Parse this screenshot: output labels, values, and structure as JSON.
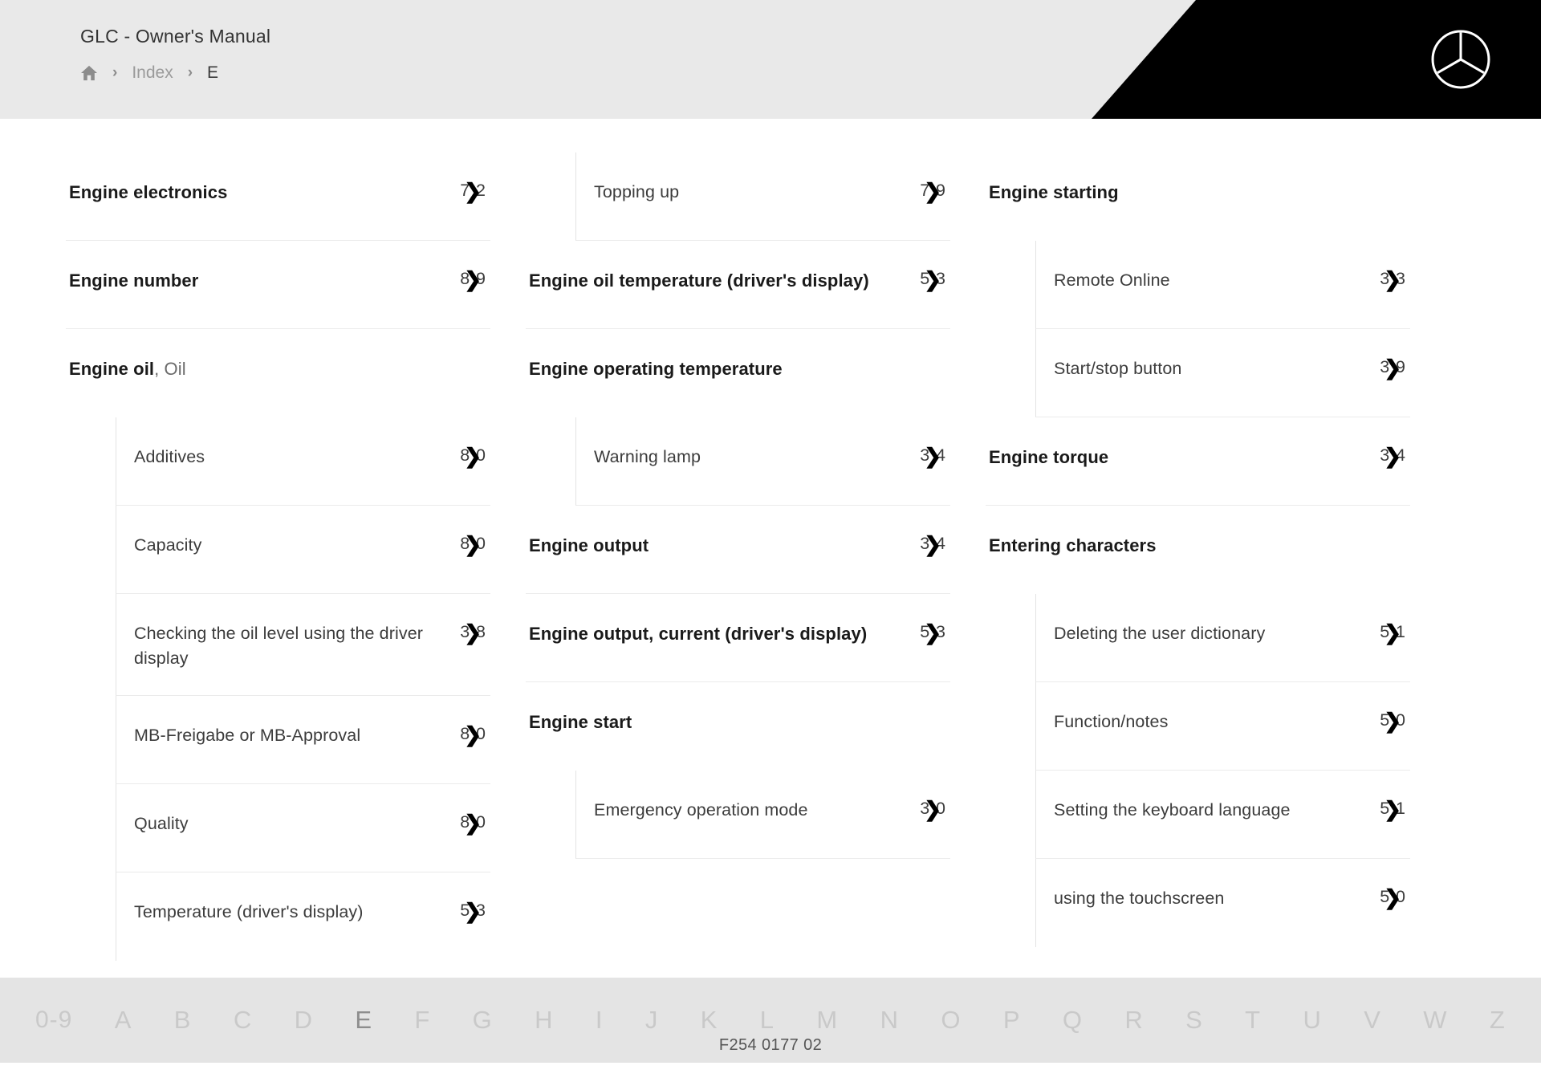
{
  "header": {
    "manual_title": "GLC - Owner's Manual",
    "breadcrumb": {
      "home_icon": "home-icon",
      "separator": "›",
      "items": [
        {
          "label": "Index",
          "current": false
        },
        {
          "label": "E",
          "current": true
        }
      ]
    },
    "brand_logo": "mercedes-benz-star-icon"
  },
  "index": {
    "columns": [
      {
        "entries": [
          {
            "label": "Engine electronics",
            "bold": true,
            "level": 0,
            "page": {
              "d1": "7",
              "chevron": "❯",
              "d2": "2"
            },
            "divider": true
          },
          {
            "label": "Engine number",
            "bold": true,
            "level": 0,
            "page": {
              "d1": "8",
              "chevron": "❯",
              "d2": "9"
            },
            "divider": true
          },
          {
            "label": "Engine oil",
            "suffix": ", Oil",
            "bold": true,
            "level": 0,
            "page": null,
            "divider": false
          },
          {
            "label": "Additives",
            "bold": false,
            "level": 1,
            "page": {
              "d1": "8",
              "chevron": "❯",
              "d2": "0"
            },
            "divider": true
          },
          {
            "label": "Capacity",
            "bold": false,
            "level": 1,
            "page": {
              "d1": "8",
              "chevron": "❯",
              "d2": "0"
            },
            "divider": true
          },
          {
            "label": "Checking the oil level using the driver display",
            "bold": false,
            "level": 1,
            "page": {
              "d1": "3",
              "chevron": "❯",
              "d2": "8"
            },
            "divider": true
          },
          {
            "label": "MB-Freigabe or MB-Approval",
            "bold": false,
            "level": 1,
            "page": {
              "d1": "8",
              "chevron": "❯",
              "d2": "0"
            },
            "divider": true
          },
          {
            "label": "Quality",
            "bold": false,
            "level": 1,
            "page": {
              "d1": "8",
              "chevron": "❯",
              "d2": "0"
            },
            "divider": true
          },
          {
            "label": "Temperature (driver's display)",
            "bold": false,
            "level": 1,
            "page": {
              "d1": "5",
              "chevron": "❯",
              "d2": "3"
            },
            "divider": false
          }
        ]
      },
      {
        "entries": [
          {
            "label": "Topping up",
            "bold": false,
            "level": 1,
            "page": {
              "d1": "7",
              "chevron": "❯",
              "d2": "9"
            },
            "divider": true
          },
          {
            "label": "Engine oil temperature (driver's display)",
            "bold": true,
            "level": 0,
            "page": {
              "d1": "5",
              "chevron": "❯",
              "d2": "3"
            },
            "divider": true
          },
          {
            "label": "Engine operating temperature",
            "bold": true,
            "level": 0,
            "page": null,
            "divider": false
          },
          {
            "label": "Warning lamp",
            "bold": false,
            "level": 1,
            "page": {
              "d1": "3",
              "chevron": "❯",
              "d2": "4"
            },
            "divider": true
          },
          {
            "label": "Engine output",
            "bold": true,
            "level": 0,
            "page": {
              "d1": "3",
              "chevron": "❯",
              "d2": "4"
            },
            "divider": true
          },
          {
            "label": "Engine output, current (driver's display)",
            "bold": true,
            "level": 0,
            "page": {
              "d1": "5",
              "chevron": "❯",
              "d2": "3"
            },
            "divider": true
          },
          {
            "label": "Engine start",
            "bold": true,
            "level": 0,
            "page": null,
            "divider": false
          },
          {
            "label": "Emergency operation mode",
            "bold": false,
            "level": 1,
            "page": {
              "d1": "3",
              "chevron": "❯",
              "d2": "0"
            },
            "divider": true
          }
        ]
      },
      {
        "entries": [
          {
            "label": "Engine starting",
            "bold": true,
            "level": 0,
            "page": null,
            "divider": false
          },
          {
            "label": "Remote Online",
            "bold": false,
            "level": 1,
            "page": {
              "d1": "3",
              "chevron": "❯",
              "d2": "3"
            },
            "divider": true
          },
          {
            "label": "Start/stop button",
            "bold": false,
            "level": 1,
            "page": {
              "d1": "3",
              "chevron": "❯",
              "d2": "9"
            },
            "divider": true
          },
          {
            "label": "Engine torque",
            "bold": true,
            "level": 0,
            "page": {
              "d1": "3",
              "chevron": "❯",
              "d2": "4"
            },
            "divider": true
          },
          {
            "label": "Entering characters",
            "bold": true,
            "level": 0,
            "page": null,
            "divider": false
          },
          {
            "label": "Deleting the user dictionary",
            "bold": false,
            "level": 1,
            "page": {
              "d1": "5",
              "chevron": "❯",
              "d2": "1"
            },
            "divider": true
          },
          {
            "label": "Function/notes",
            "bold": false,
            "level": 1,
            "page": {
              "d1": "5",
              "chevron": "❯",
              "d2": "0"
            },
            "divider": true
          },
          {
            "label": "Setting the keyboard language",
            "bold": false,
            "level": 1,
            "page": {
              "d1": "5",
              "chevron": "❯",
              "d2": "1"
            },
            "divider": true
          },
          {
            "label": "using the touchscreen",
            "bold": false,
            "level": 1,
            "page": {
              "d1": "5",
              "chevron": "❯",
              "d2": "0"
            },
            "divider": false
          }
        ]
      }
    ]
  },
  "alphabet_bar": {
    "active": "E",
    "items": [
      "0-9",
      "A",
      "B",
      "C",
      "D",
      "E",
      "F",
      "G",
      "H",
      "I",
      "J",
      "K",
      "L",
      "M",
      "N",
      "O",
      "P",
      "Q",
      "R",
      "S",
      "T",
      "U",
      "V",
      "W",
      "Z"
    ]
  },
  "footer": {
    "document_code": "F254 0177 02"
  },
  "colors": {
    "header_bg": "#e9e9e9",
    "header_accent": "#000000",
    "alpha_bar_bg": "#e4e4e4",
    "text_primary": "#1a1a1a",
    "text_secondary": "#3c3c3c",
    "text_muted": "#9a9a9a",
    "divider": "#ebebeb"
  }
}
